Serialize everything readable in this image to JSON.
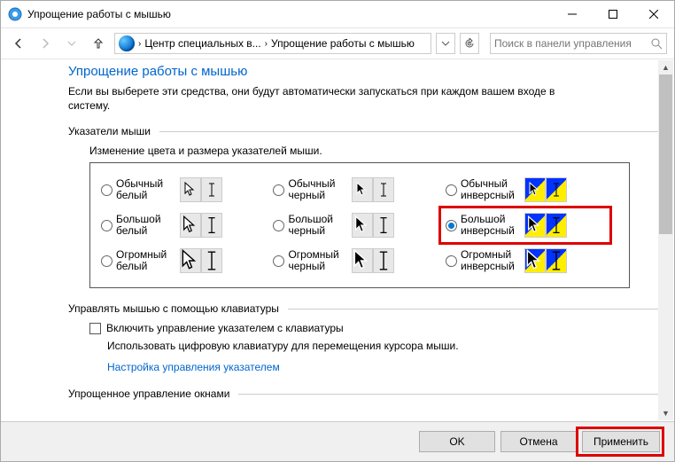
{
  "window": {
    "title": "Упрощение работы с мышью"
  },
  "breadcrumb": {
    "item1": "Центр специальных в...",
    "item2": "Упрощение работы с мышью"
  },
  "search": {
    "placeholder": "Поиск в панели управления"
  },
  "page": {
    "heading": "Упрощение работы с мышью",
    "desc": "Если вы выберете эти средства, они будут автоматически запускаться при каждом вашем входе в систему."
  },
  "pointers": {
    "title": "Указатели мыши",
    "subdesc": "Изменение цвета и размера указателей мыши.",
    "options": {
      "r0c0": "Обычный белый",
      "r0c1": "Обычный черный",
      "r0c2": "Обычный инверсный",
      "r1c0": "Большой белый",
      "r1c1": "Большой черный",
      "r1c2": "Большой инверсный",
      "r2c0": "Огромный белый",
      "r2c1": "Огромный черный",
      "r2c2": "Огромный инверсный"
    },
    "selected": "r1c2"
  },
  "keyboard": {
    "title": "Управлять мышью с помощью клавиатуры",
    "checkbox": "Включить управление указателем с клавиатуры",
    "desc": "Использовать цифровую клавиатуру для перемещения курсора мыши.",
    "link": "Настройка управления указателем"
  },
  "windows_mgmt": {
    "title": "Упрощенное управление окнами"
  },
  "buttons": {
    "ok": "OK",
    "cancel": "Отмена",
    "apply": "Применить"
  }
}
